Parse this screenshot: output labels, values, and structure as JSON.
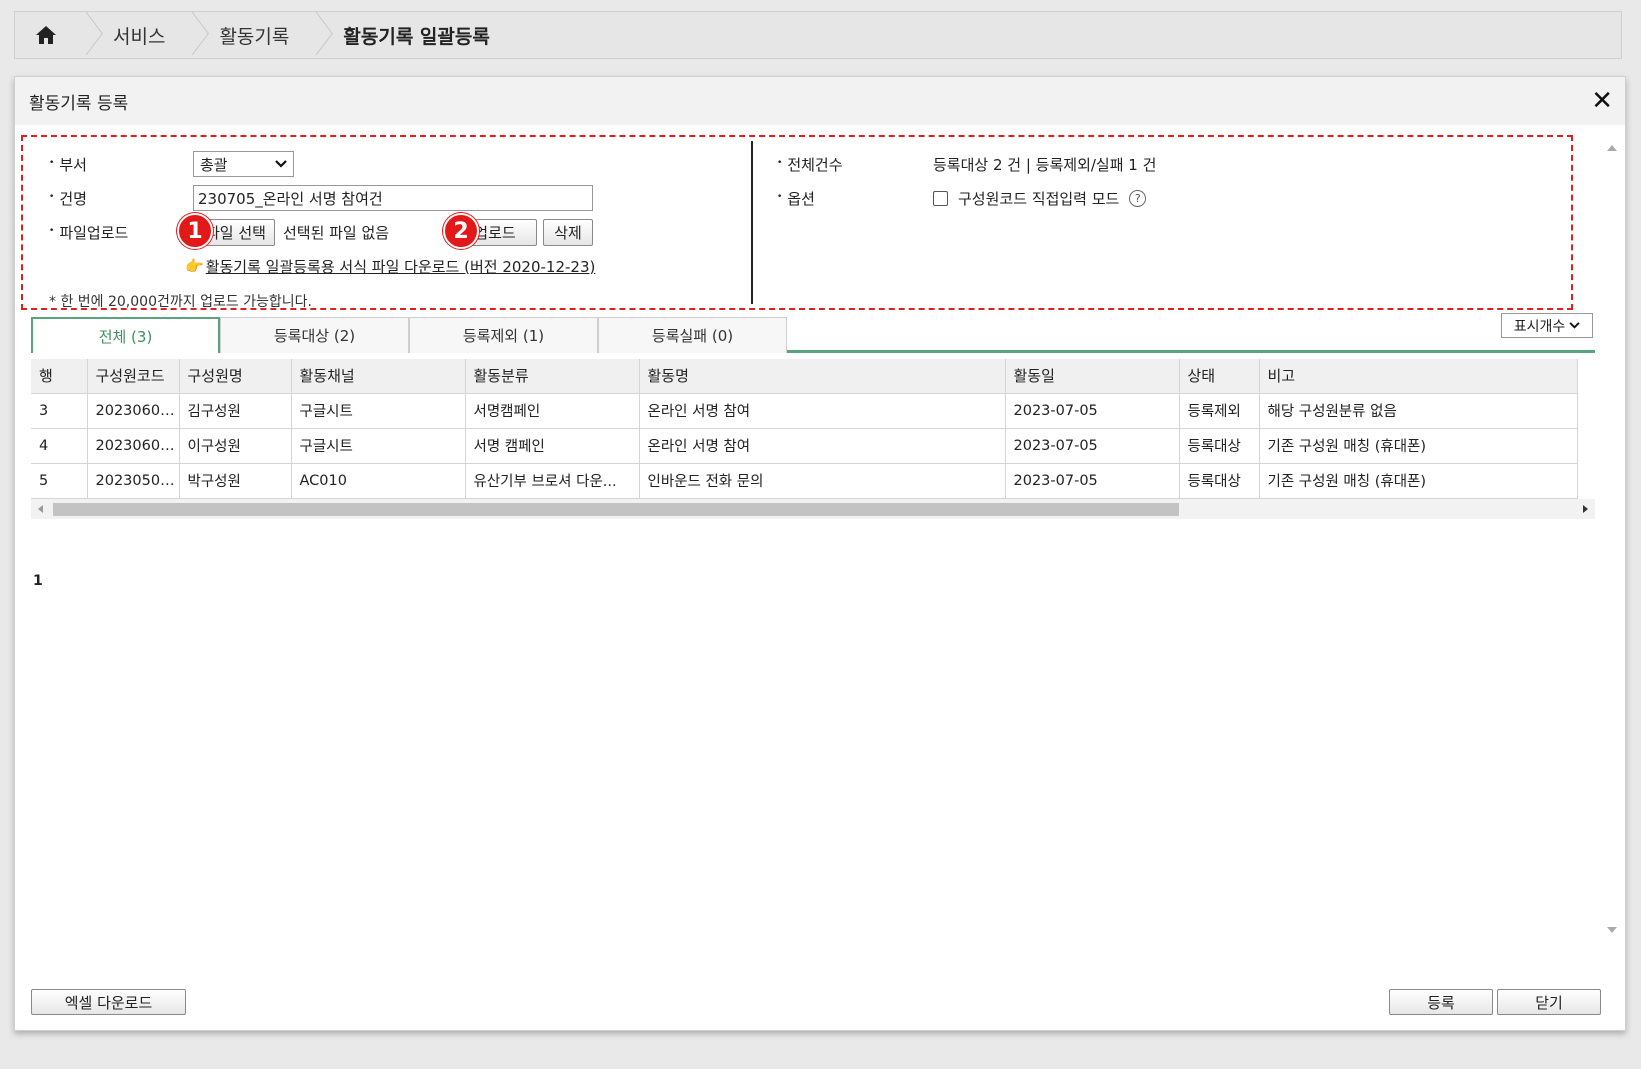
{
  "breadcrumb": {
    "items": [
      "서비스",
      "활동기록",
      "활동기록 일괄등록"
    ]
  },
  "dialog": {
    "title": "활동기록 등록"
  },
  "form": {
    "dept_label": "부서",
    "dept_value": "총괄",
    "name_label": "건명",
    "name_value": "230705_온라인 서명 참여건",
    "file_label": "파일업로드",
    "file_button": "파일 선택",
    "file_none": "선택된 파일 없음",
    "upload_button": "업로드",
    "delete_button": "삭제",
    "template_link": "활동기록 일괄등록용 서식 파일 다운로드 (버전 2020-12-23)",
    "note": "* 한 번에 20,000건까지 업로드 가능합니다.",
    "total_label": "전체건수",
    "total_value": "등록대상 2 건 | 등록제외/실패 1 건",
    "option_label": "옵션",
    "option_checkbox": "구성원코드 직접입력 모드",
    "help_icon_text": "?",
    "badges": [
      "1",
      "2"
    ]
  },
  "tabs": [
    {
      "label": "전체 (3)",
      "active": true
    },
    {
      "label": "등록대상 (2)",
      "active": false
    },
    {
      "label": "등록제외 (1)",
      "active": false
    },
    {
      "label": "등록실패 (0)",
      "active": false
    }
  ],
  "show_count_label": "표시개수",
  "table": {
    "columns": [
      "행",
      "구성원코드",
      "구성원명",
      "활동채널",
      "활동분류",
      "활동명",
      "활동일",
      "상태",
      "비고"
    ],
    "rows": [
      [
        "3",
        "20230600...",
        "김구성원",
        "구글시트",
        "서명캠페인",
        "온라인 서명 참여",
        "2023-07-05",
        "등록제외",
        "해당 구성원분류 없음"
      ],
      [
        "4",
        "20230600...",
        "이구성원",
        "구글시트",
        "서명 캠페인",
        "온라인 서명 참여",
        "2023-07-05",
        "등록대상",
        "기존 구성원 매칭 (휴대폰)"
      ],
      [
        "5",
        "20230500...",
        "박구성원",
        "AC010",
        "유산기부 브로셔 다운...",
        "인바운드 전화 문의",
        "2023-07-05",
        "등록대상",
        "기존 구성원 매칭 (휴대폰)"
      ]
    ],
    "error_color": "#e0382a"
  },
  "pagination": {
    "current": "1"
  },
  "footer": {
    "excel_button": "엑셀 다운로드",
    "register_button": "등록",
    "close_button": "닫기"
  },
  "colors": {
    "accent": "#5aa37d",
    "alert": "#e02020"
  }
}
